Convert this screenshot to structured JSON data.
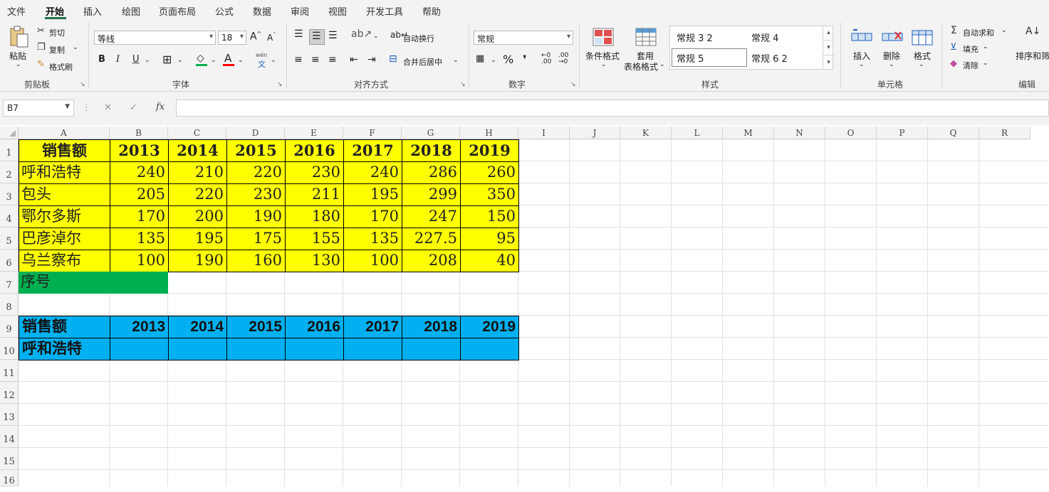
{
  "menu": [
    "文件",
    "开始",
    "插入",
    "绘图",
    "页面布局",
    "公式",
    "数据",
    "审阅",
    "视图",
    "开发工具",
    "帮助"
  ],
  "ribbon": {
    "clipboard": {
      "label": "剪贴板",
      "paste": "粘贴",
      "cut": "剪切",
      "copy": "复制",
      "format_painter": "格式刷"
    },
    "font": {
      "label": "字体",
      "font_name": "等线",
      "font_size": "18",
      "grow": "A",
      "shrink": "A",
      "bold": "B",
      "italic": "I",
      "underline": "U",
      "phonetic": "wén",
      "phonetic_char": "文"
    },
    "alignment": {
      "label": "对齐方式",
      "wrap_text": "自动换行",
      "merge_center": "合并后居中"
    },
    "number": {
      "label": "数字",
      "format": "常规",
      "percent": "%",
      "comma": "❜"
    },
    "styles": {
      "label": "样式",
      "conditional_format": "条件格式",
      "table_format_1": "套用",
      "table_format_2": "表格格式",
      "cells": [
        "常规 3 2",
        "常规 4",
        "常规 5",
        "常规 6 2"
      ]
    },
    "cells": {
      "label": "单元格",
      "insert": "插入",
      "delete": "删除",
      "format": "格式"
    },
    "editing": {
      "label": "编辑",
      "autosum": "自动求和",
      "fill": "填充",
      "clear": "清除",
      "sort_filter": "排序和筛"
    }
  },
  "formula_bar": {
    "name_box": "B7",
    "cancel": "✕",
    "enter": "✓",
    "fx": "fx",
    "value": ""
  },
  "columns": [
    "A",
    "B",
    "C",
    "D",
    "E",
    "F",
    "G",
    "H",
    "I",
    "J",
    "K",
    "L",
    "M",
    "N",
    "O",
    "P",
    "Q",
    "R"
  ],
  "rows": [
    "1",
    "2",
    "3",
    "4",
    "5",
    "6",
    "7",
    "8",
    "9",
    "10",
    "11",
    "12",
    "13",
    "14",
    "15",
    "16"
  ],
  "table1": {
    "header": [
      "销售额",
      "2013",
      "2014",
      "2015",
      "2016",
      "2017",
      "2018",
      "2019"
    ],
    "rows": [
      [
        "呼和浩特",
        "240",
        "210",
        "220",
        "230",
        "240",
        "286",
        "260"
      ],
      [
        "包头",
        "205",
        "220",
        "230",
        "211",
        "195",
        "299",
        "350"
      ],
      [
        "鄂尔多斯",
        "170",
        "200",
        "190",
        "180",
        "170",
        "247",
        "150"
      ],
      [
        "巴彦淖尔",
        "135",
        "195",
        "175",
        "155",
        "135",
        "227.5",
        "95"
      ],
      [
        "乌兰察布",
        "100",
        "190",
        "160",
        "130",
        "100",
        "208",
        "40"
      ]
    ]
  },
  "row7_label": "序号",
  "table2": {
    "header": [
      "销售额",
      "2013",
      "2014",
      "2015",
      "2016",
      "2017",
      "2018",
      "2019"
    ],
    "row": [
      "呼和浩特",
      "",
      "",
      "",
      "",
      "",
      "",
      ""
    ]
  },
  "colors": {
    "yellow": "#ffff00",
    "green": "#00b050",
    "blue": "#00b0f0",
    "accent": "#217346"
  }
}
